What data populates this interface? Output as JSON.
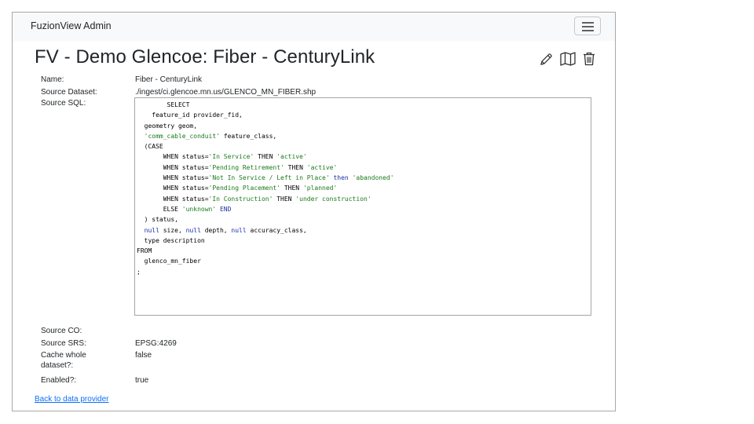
{
  "navbar": {
    "brand": "FuzionView Admin"
  },
  "page": {
    "title": "FV - Demo Glencoe: Fiber - CenturyLink"
  },
  "actions": {
    "icons": [
      "pencil-icon",
      "map-icon",
      "trash-icon"
    ]
  },
  "fields": {
    "name_label": "Name:",
    "name_value": "Fiber - CenturyLink",
    "dataset_label": "Source Dataset:",
    "dataset_value": "./ingest/ci.glencoe.mn.us/GLENCO_MN_FIBER.shp",
    "sql_label": "Source SQL:",
    "co_label": "Source CO:",
    "co_value": "",
    "srs_label": "Source SRS:",
    "srs_value": "EPSG:4269",
    "cache_label": "Cache whole dataset?:",
    "cache_value": "false",
    "enabled_label": "Enabled?:",
    "enabled_value": "true"
  },
  "sql": [
    [
      {
        "t": "        SELECT"
      }
    ],
    [
      {
        "t": "    feature_id provider_fid,"
      }
    ],
    [
      {
        "t": "  geometry geom,"
      }
    ],
    [
      {
        "t": "  "
      },
      {
        "t": "'comm_cable_conduit'",
        "c": "str"
      },
      {
        "t": " feature_class,"
      }
    ],
    [
      {
        "t": "  (CASE"
      }
    ],
    [
      {
        "t": "       WHEN status="
      },
      {
        "t": "'In Service'",
        "c": "str"
      },
      {
        "t": " THEN "
      },
      {
        "t": "'active'",
        "c": "str"
      }
    ],
    [
      {
        "t": "       WHEN status="
      },
      {
        "t": "'Pending Retirement'",
        "c": "str"
      },
      {
        "t": " THEN "
      },
      {
        "t": "'active'",
        "c": "str"
      }
    ],
    [
      {
        "t": "       WHEN status="
      },
      {
        "t": "'Not In Service / Left in Place'",
        "c": "str"
      },
      {
        "t": " "
      },
      {
        "t": "then",
        "c": "kw"
      },
      {
        "t": " "
      },
      {
        "t": "'abandoned'",
        "c": "str"
      }
    ],
    [
      {
        "t": "       WHEN status="
      },
      {
        "t": "'Pending Placement'",
        "c": "str"
      },
      {
        "t": " THEN "
      },
      {
        "t": "'planned'",
        "c": "str"
      }
    ],
    [
      {
        "t": "       WHEN status="
      },
      {
        "t": "'In Construction'",
        "c": "str"
      },
      {
        "t": " THEN "
      },
      {
        "t": "'under construction'",
        "c": "str"
      }
    ],
    [
      {
        "t": "       ELSE "
      },
      {
        "t": "'unknown'",
        "c": "str"
      },
      {
        "t": " "
      },
      {
        "t": "END",
        "c": "kw"
      }
    ],
    [
      {
        "t": "  ) status,"
      }
    ],
    [
      {
        "t": "  "
      },
      {
        "t": "null",
        "c": "kw"
      },
      {
        "t": " size, "
      },
      {
        "t": "null",
        "c": "kw"
      },
      {
        "t": " depth, "
      },
      {
        "t": "null",
        "c": "kw"
      },
      {
        "t": " accuracy_class,"
      }
    ],
    [
      {
        "t": "  type description"
      }
    ],
    [
      {
        "t": "FROM"
      }
    ],
    [
      {
        "t": "  glenco_mn_fiber"
      }
    ],
    [
      {
        "t": ";"
      }
    ]
  ],
  "footer": {
    "back_link": "Back to data provider"
  }
}
